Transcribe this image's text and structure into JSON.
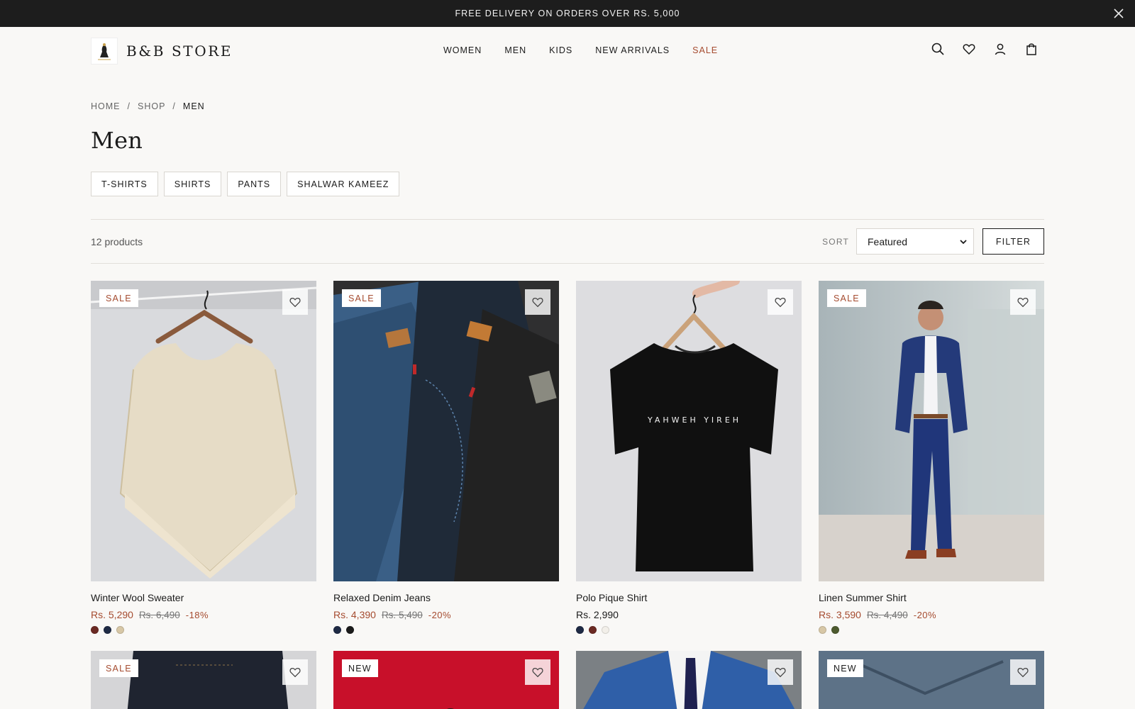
{
  "announcement": {
    "text": "FREE DELIVERY ON ORDERS OVER RS. 5,000",
    "close_icon": "close-icon"
  },
  "header": {
    "brand": "B&B STORE",
    "logo_icon": "brand-logo",
    "nav": [
      "WOMEN",
      "MEN",
      "KIDS",
      "NEW ARRIVALS",
      "SALE"
    ],
    "icons": [
      "search-icon",
      "heart-icon",
      "user-icon",
      "bag-icon"
    ]
  },
  "breadcrumb": [
    "HOME",
    "/",
    "SHOP",
    "/",
    "MEN"
  ],
  "page_title": "Men",
  "categories": [
    "T-SHIRTS",
    "SHIRTS",
    "PANTS",
    "SHALWAR KAMEEZ"
  ],
  "toolbar": {
    "count": "12 products",
    "sort_label": "SORT",
    "sort_value": "Featured",
    "filter_label": "FILTER"
  },
  "colors": {
    "accent": "#a54b2f",
    "dark": "#1d1d1d",
    "background": "#f9f8f6"
  },
  "products": [
    {
      "badge": "SALE",
      "name": "Winter Wool Sweater",
      "price": "Rs. 5,290",
      "original": "Rs. 6,490",
      "discount": "-18%",
      "swatches": [
        "#6b2a23",
        "#1e2a44",
        "#d7c7a6"
      ]
    },
    {
      "badge": "SALE",
      "name": "Relaxed Denim Jeans",
      "price": "Rs. 4,390",
      "original": "Rs. 5,490",
      "discount": "-20%",
      "swatches": [
        "#1e2a44",
        "#1b1b1b"
      ]
    },
    {
      "badge": "",
      "name": "Polo Pique Shirt",
      "price": "Rs. 2,990",
      "original": "",
      "discount": "",
      "swatches": [
        "#1e2a44",
        "#6b2a23",
        "#f2efe9"
      ]
    },
    {
      "badge": "SALE",
      "name": "Linen Summer Shirt",
      "price": "Rs. 3,590",
      "original": "Rs. 4,490",
      "discount": "-20%",
      "swatches": [
        "#d7c7a6",
        "#4d5a2e"
      ]
    }
  ],
  "products_row2_badges": [
    "SALE",
    "NEW",
    "",
    "NEW"
  ],
  "art_text": "YAHWEH YIREH"
}
